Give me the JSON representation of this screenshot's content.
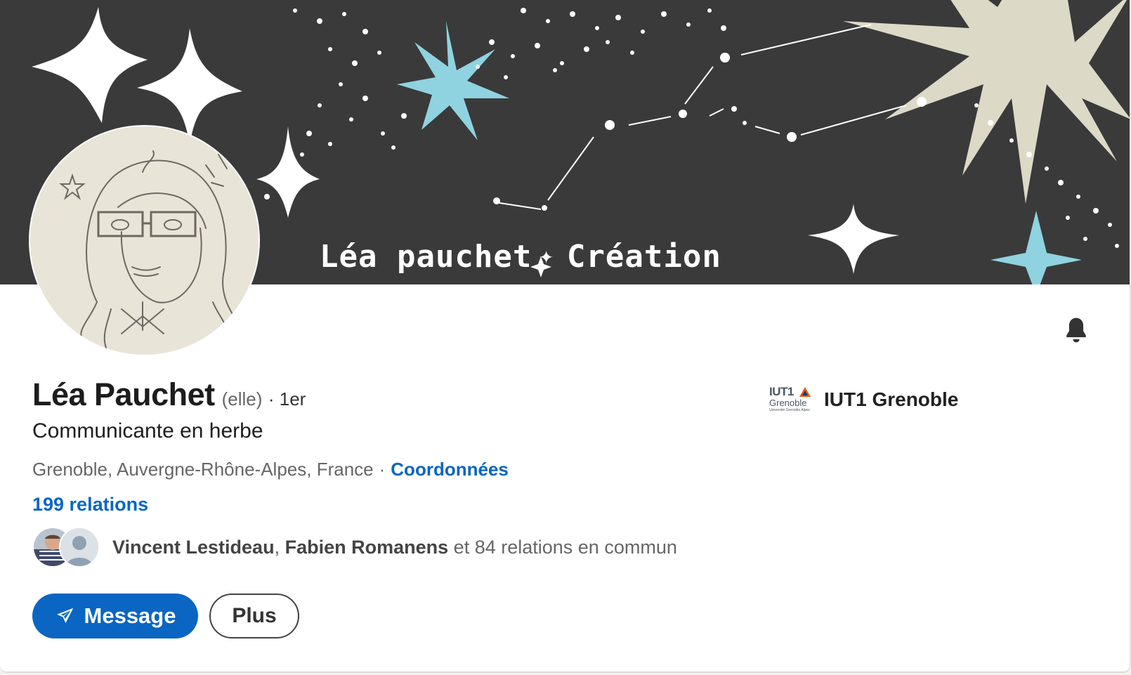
{
  "banner": {
    "text_left": "Léa pauchet",
    "text_right": "Création"
  },
  "profile": {
    "name": "Léa Pauchet",
    "pronouns": "(elle)",
    "degree": "· 1er",
    "headline": "Communicante en herbe",
    "location": "Grenoble, Auvergne-Rhône-Alpes, France",
    "location_separator": "·",
    "contact_link": "Coordonnées",
    "relations": "199 relations"
  },
  "mutual": {
    "person1": "Vincent Lestideau",
    "comma": ",",
    "person2": "Fabien Romanens",
    "rest": "et 84 relations en commun"
  },
  "actions": {
    "message_label": "Message",
    "more_label": "Plus"
  },
  "education": {
    "logo_line1": "IUT1",
    "logo_line2": "Grenoble",
    "logo_line3": "Université Grenoble Alpes",
    "name": "IUT1 Grenoble"
  },
  "colors": {
    "accent": "#0a66c2",
    "banner_bg": "#3a3a3a",
    "star_blue": "#8fd3e0",
    "star_cream": "#ddd9c7"
  },
  "icons": {
    "bell": "bell-icon",
    "message": "send-icon"
  }
}
